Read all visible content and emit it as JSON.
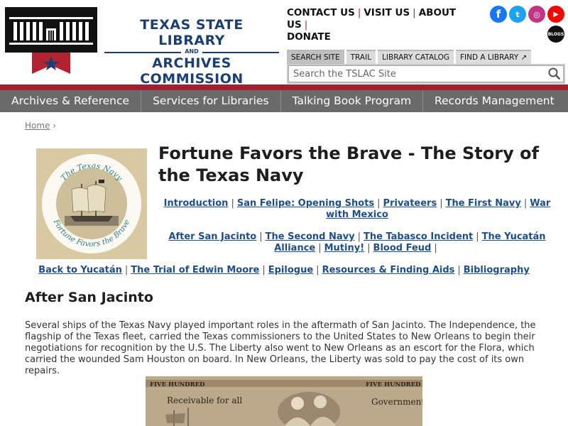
{
  "header": {
    "logo_line1": "TEXAS STATE LIBRARY",
    "logo_and": "AND",
    "logo_line2": "ARCHIVES COMMISSION",
    "top_links": [
      "CONTACT US",
      "VISIT US",
      "ABOUT US",
      "DONATE"
    ],
    "social": {
      "facebook": "f",
      "twitter": "t",
      "instagram": "◎",
      "youtube": "▶",
      "blogs": "BLOGS"
    },
    "search": {
      "tabs": [
        "SEARCH SITE",
        "TRAIL",
        "LIBRARY CATALOG",
        "FIND A LIBRARY"
      ],
      "placeholder": "Search the TSLAC Site"
    }
  },
  "nav": [
    "Archives & Reference",
    "Services for Libraries",
    "Talking Book Program",
    "Records Management"
  ],
  "breadcrumb": {
    "home": "Home",
    "sep": "›"
  },
  "emblem": {
    "top_text": "The Texas Navy",
    "bottom_text": "Fortune Favors the Brave"
  },
  "page": {
    "title": "Fortune Favors the Brave - The Story of the Texas Navy",
    "links_row1": [
      "Introduction",
      "San Felipe: Opening Shots",
      "Privateers",
      "The First Navy",
      "War with Mexico"
    ],
    "links_row2": [
      "After San Jacinto",
      "The Second Navy",
      "The Tabasco Incident",
      "The Yucatán Alliance",
      "Mutiny!",
      "Blood Feud"
    ],
    "links_row3": [
      "Back to Yucatán",
      "The Trial of  Edwin Moore",
      "Epilogue",
      "Resources & Finding Aids",
      "Bibliography"
    ],
    "section_heading": "After San Jacinto",
    "paragraph": "Several ships of the Texas Navy played important roles in the aftermath of San Jacinto. The Independence, the flagship of the Texas fleet, carried the Texas commissioners to the United States to New Orleans to begin their negotiations for recognition by the U.S. The Liberty also went to New Orleans as an escort for the Flora, which carried the wounded Sam Houston on board. In New Orleans, the Liberty was sold to pay the cost of its own repairs.",
    "banknote": {
      "corner_left": "FIVE HUNDRED",
      "corner_right": "FIVE HUNDRED",
      "receivable": "Receivable for all",
      "government": "Government"
    }
  },
  "colors": {
    "brand_blue": "#1b3f75",
    "brand_red": "#b3232f",
    "nav_gray": "#6a6a6a",
    "link_blue": "#1e4d8c"
  }
}
